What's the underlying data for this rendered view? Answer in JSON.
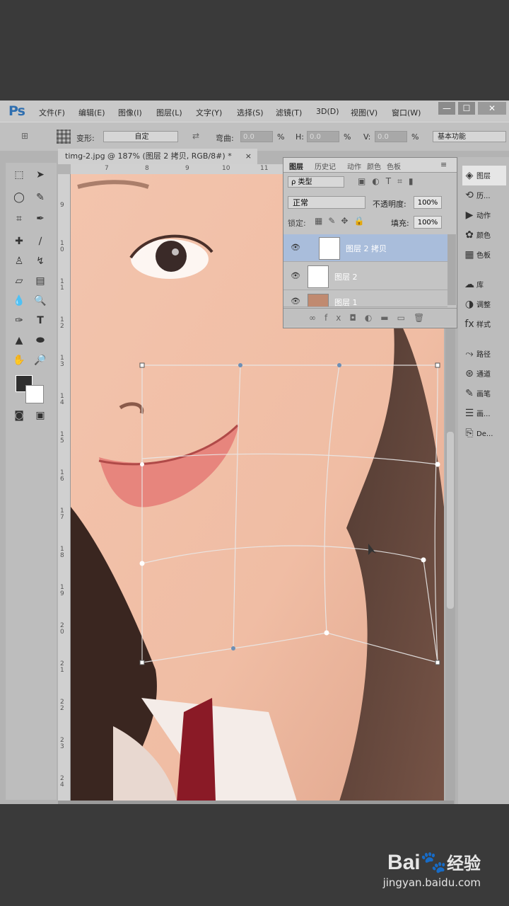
{
  "app": {
    "logo": "Ps"
  },
  "menu": [
    "文件(F)",
    "编辑(E)",
    "图像(I)",
    "图层(L)",
    "文字(Y)",
    "选择(S)",
    "滤镜(T)",
    "3D(D)",
    "视图(V)",
    "窗口(W)"
  ],
  "window_buttons": [
    "—",
    "☐",
    "✕"
  ],
  "options": {
    "warp_label": "变形:",
    "warp_value": "自定",
    "bend_label": "弯曲:",
    "bend_value": "0.0",
    "h_label": "H:",
    "h_value": "0.0",
    "v_label": "V:",
    "v_value": "0.0",
    "percent": "%",
    "workspace": "基本功能"
  },
  "document": {
    "tab_title": "timg-2.jpg @ 187% (图层 2 拷贝, RGB/8#) *",
    "close": "×"
  },
  "ruler_top": [
    "7",
    "8",
    "9",
    "10",
    "11"
  ],
  "ruler_left": [
    "9",
    "1 0",
    "1 1",
    "1 2",
    "1 3",
    "1 4",
    "1 5",
    "1 6",
    "1 7",
    "1 8",
    "1 9",
    "2 0",
    "2 1",
    "2 2",
    "2 3",
    "2 4"
  ],
  "layers_panel": {
    "tabs": [
      "图层",
      "历史记",
      "动作",
      "颜色",
      "色板"
    ],
    "filter": "ρ 类型",
    "blend_mode": "正常",
    "opacity_label": "不透明度:",
    "opacity_value": "100%",
    "lock_label": "锁定:",
    "fill_label": "填充:",
    "fill_value": "100%",
    "layers": [
      {
        "name": "图层 2 拷贝",
        "selected": true
      },
      {
        "name": "图层 2",
        "selected": false
      },
      {
        "name": "图层 1",
        "selected": false
      }
    ]
  },
  "right_panel": [
    "图层",
    "历...",
    "动作",
    "颜色",
    "色板",
    "库",
    "调整",
    "样式",
    "路径",
    "通道",
    "画笔",
    "画...",
    "De..."
  ],
  "watermark": {
    "brand": "Bai",
    "brand2": "经验",
    "url": "jingyan.baidu.com"
  },
  "colors": {
    "accent": "#2f6fb0",
    "selected_layer": "#a9bddb"
  }
}
